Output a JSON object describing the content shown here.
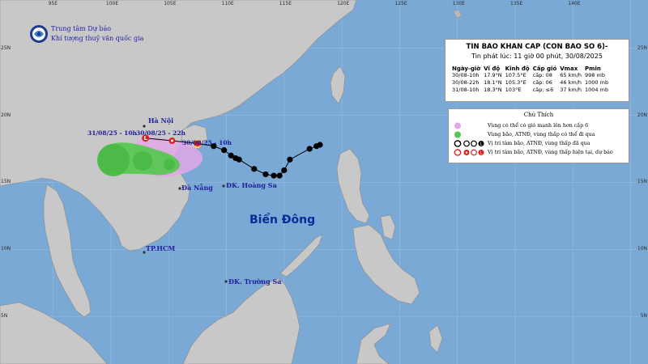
{
  "agency": {
    "name_line1": "Trung tâm Dự báo",
    "name_line2": "Khí tượng thuỷ văn quốc gia"
  },
  "bulletin": {
    "title": "TIN BAO KHAN CAP (CON BAO SO 6)-",
    "issued": "Tin phát lúc: 11 giờ 00 phút, 30/08/2025",
    "columns": [
      "Ngày-giờ",
      "Vĩ độ",
      "Kinh độ",
      "Cấp gió",
      "Vmax",
      "Pmin"
    ],
    "rows": [
      [
        "30/08-10h",
        "17.9°N",
        "107.5°E",
        "cấp: 08",
        "65 km/h",
        "998 mb"
      ],
      [
        "30/08-22h",
        "18.1°N",
        "105.3°E",
        "cấp: 06",
        "46 km/h",
        "1000 mb"
      ],
      [
        "31/08-10h",
        "18.3°N",
        "103°E",
        "cấp: ≤6",
        "37 km/h",
        "1004 mb"
      ]
    ]
  },
  "legend": {
    "title": "Chú Thích",
    "items": [
      {
        "symbol": "pink-circle",
        "text": "Vùng có thể có gió mạnh lên hơn cấp 6"
      },
      {
        "symbol": "green-circle",
        "text": "Vùng bão, ATNĐ, vùng thấp có thể đi qua"
      },
      {
        "symbol": "black-storm-symbols",
        "text": "Vị trí tâm bão, ATNĐ, vùng thấp đã qua"
      },
      {
        "symbol": "red-storm-symbols",
        "text": "Vị trí tâm bão, ATNĐ, vùng thấp hiện tại, dự báo"
      }
    ]
  },
  "ticks": {
    "longitude": [
      "95E",
      "100E",
      "105E",
      "110E",
      "115E",
      "120E",
      "125E",
      "130E",
      "135E",
      "140E"
    ],
    "latitude": [
      "25N",
      "20N",
      "15N",
      "10N",
      "5N"
    ]
  },
  "places": {
    "hanoi": "Hà Nội",
    "danang": "Đà Nẵng",
    "hcm": "TP.HCM",
    "hoangsa": "ĐK. Hoàng Sa",
    "truongsa": "ĐK. Trường Sa",
    "sea": "Biển Đông"
  },
  "forecast_times": {
    "t_31_10": "31/08/25 - 10h",
    "t_30_22": "30/08/25 - 22h",
    "t_30_10": "30/08/25 - 10h"
  },
  "colors": {
    "sea": "#7aa9d6",
    "land": "#c8c8c8",
    "land_border": "#8a8a8a",
    "wind_zone": "#e2a8e6",
    "storm_zone": "#55c84f",
    "track": "#000000",
    "current": "#e02020",
    "text_blue": "#22229c"
  },
  "track": {
    "past_points": [
      {
        "lat": 17.7,
        "lon": 108.9
      },
      {
        "lat": 17.4,
        "lon": 109.8
      },
      {
        "lat": 17.0,
        "lon": 110.4
      },
      {
        "lat": 16.8,
        "lon": 110.8
      },
      {
        "lat": 16.7,
        "lon": 111.1
      },
      {
        "lat": 16.0,
        "lon": 112.4
      },
      {
        "lat": 15.6,
        "lon": 113.4
      },
      {
        "lat": 15.5,
        "lon": 114.1
      },
      {
        "lat": 15.5,
        "lon": 114.6
      },
      {
        "lat": 15.9,
        "lon": 115.0
      },
      {
        "lat": 16.7,
        "lon": 115.5
      },
      {
        "lat": 17.5,
        "lon": 117.2
      },
      {
        "lat": 17.7,
        "lon": 117.8
      },
      {
        "lat": 17.8,
        "lon": 118.1
      }
    ],
    "current": {
      "lat": 17.9,
      "lon": 107.5
    },
    "forecast": [
      {
        "lat": 18.1,
        "lon": 105.3
      },
      {
        "lat": 18.3,
        "lon": 103.0
      }
    ]
  }
}
